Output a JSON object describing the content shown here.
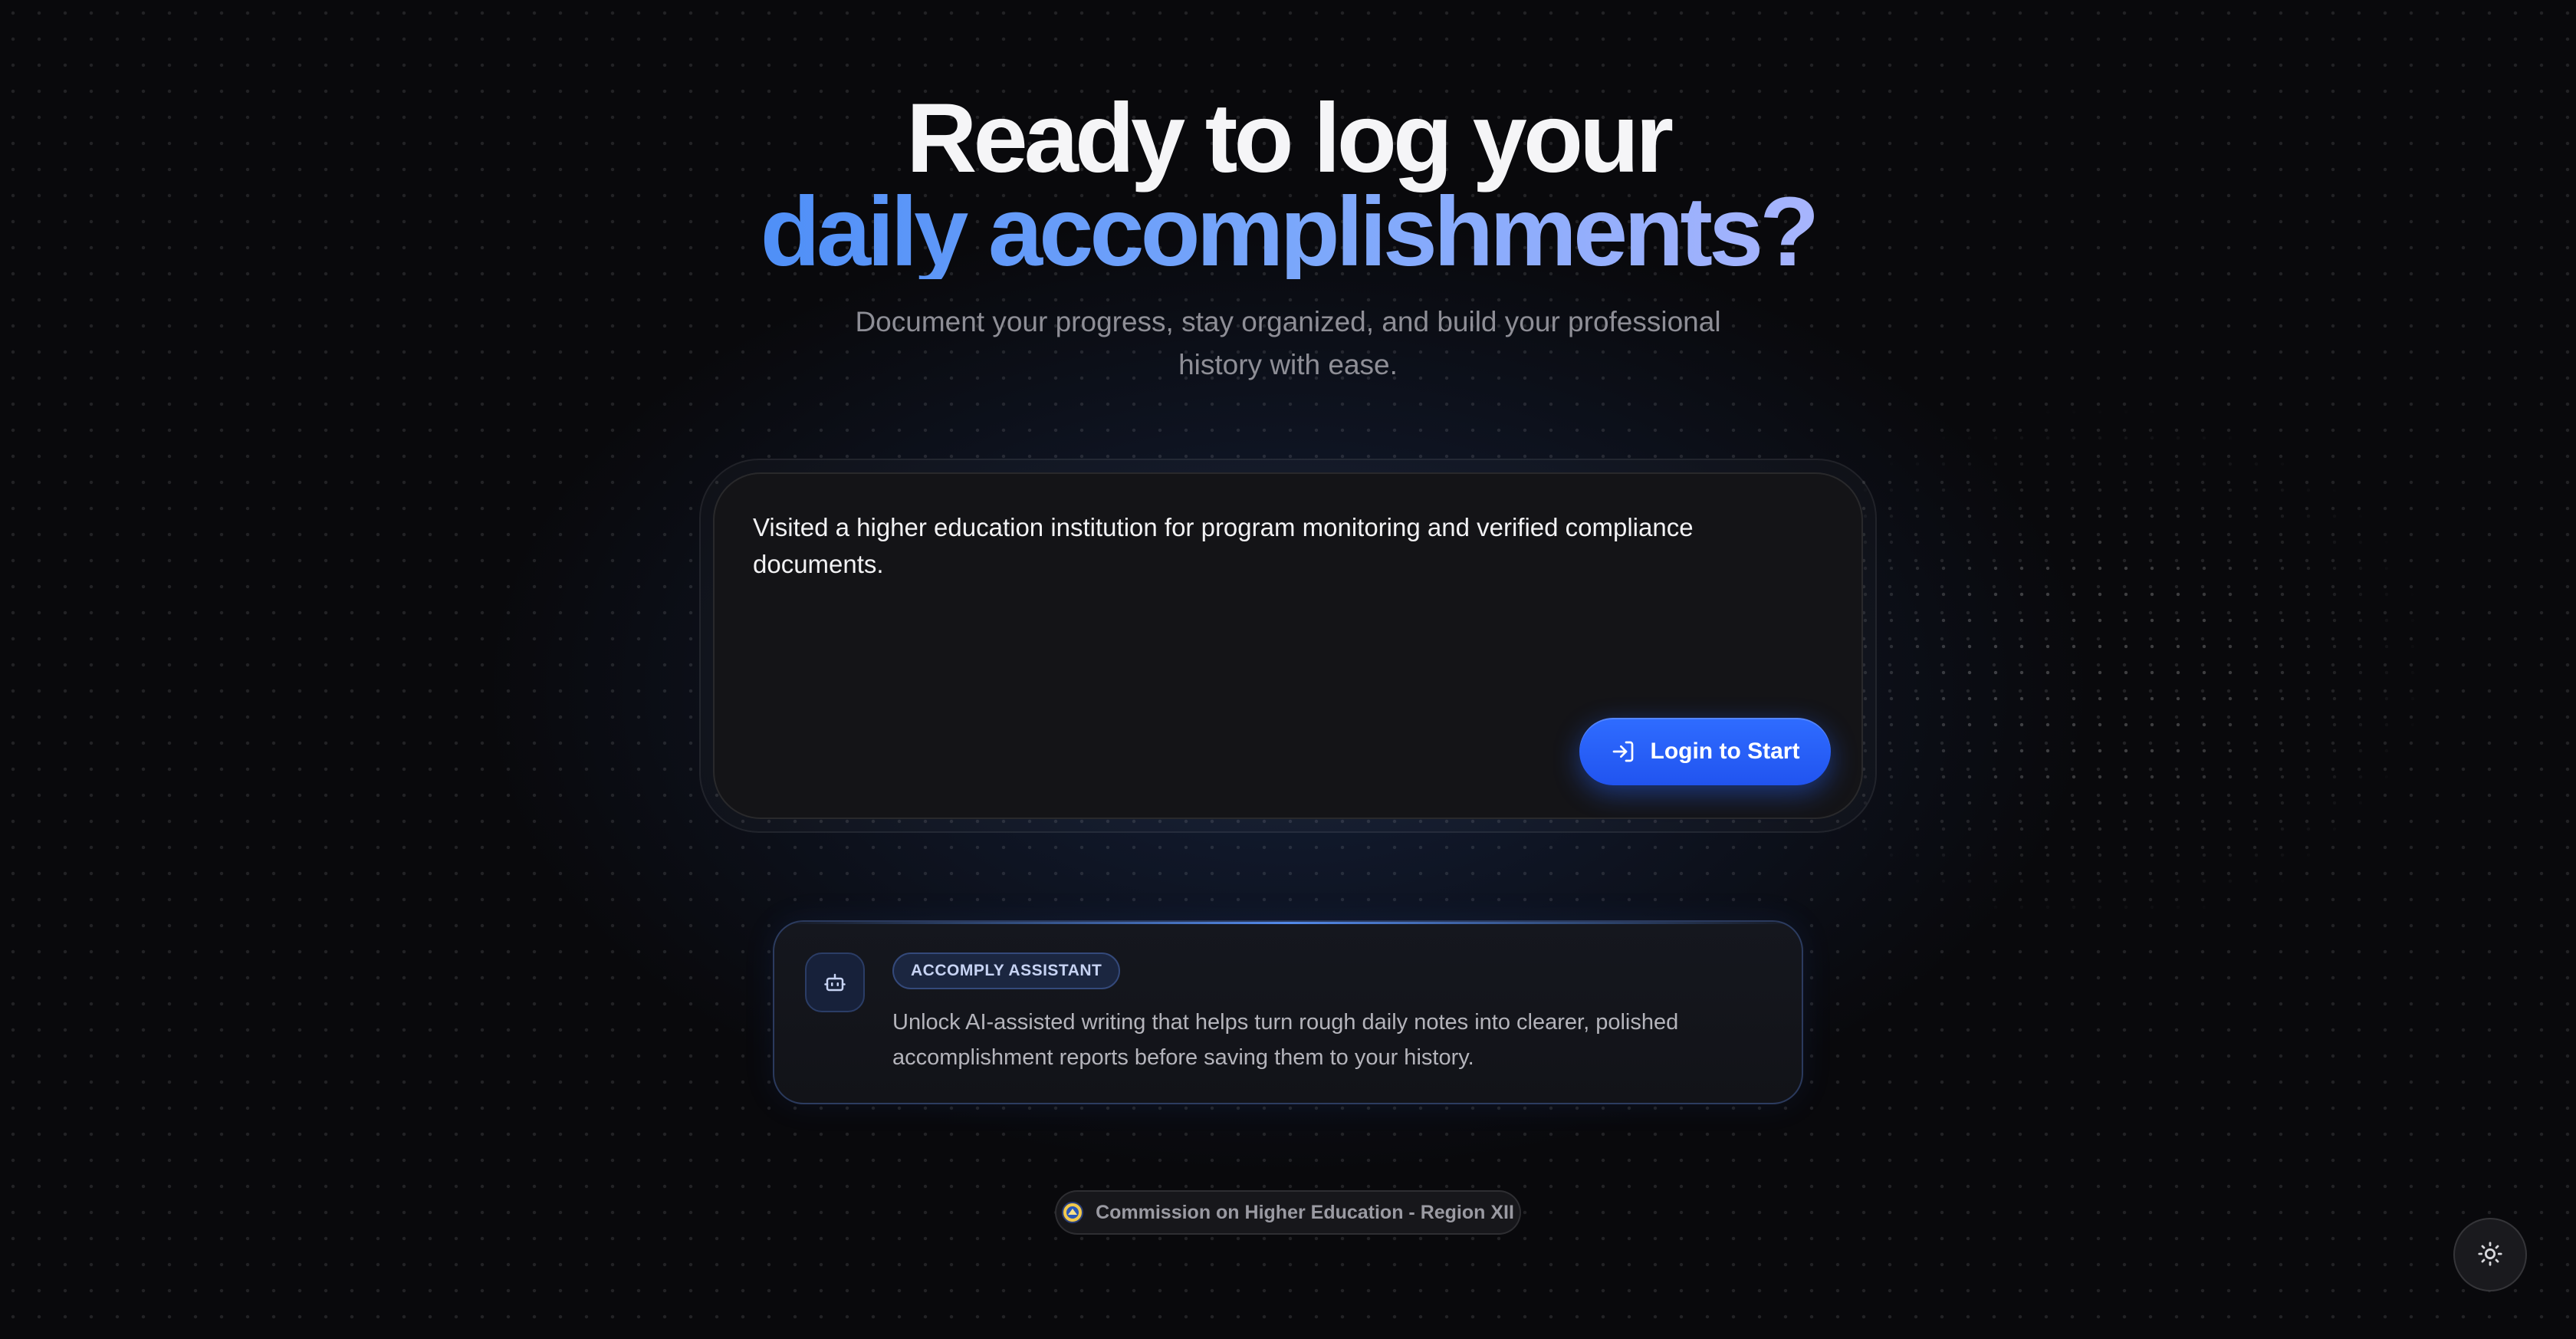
{
  "hero": {
    "headline_line1": "Ready to log your",
    "headline_line2": "daily accomplishments?",
    "subtitle": "Document your progress, stay organized, and build your professional history with ease."
  },
  "entry": {
    "text": "Visited a higher education institution for program monitoring and verified compliance documents.",
    "login_button_label": "Login to Start",
    "login_icon": "login-arrow-icon"
  },
  "assistant": {
    "icon": "robot-icon",
    "badge": "ACCOMPLY ASSISTANT",
    "description": "Unlock AI-assisted writing that helps turn rough daily notes into clearer, polished accomplishment reports before saving them to your history."
  },
  "footer": {
    "organization": "Commission on Higher Education - Region XII",
    "icon": "seal-icon"
  },
  "theme_toggle": {
    "icon": "sun-icon"
  },
  "colors": {
    "background": "#09090c",
    "accent": "#2f6cff",
    "headline_gradient_start": "#4f8ff7",
    "headline_gradient_end": "#a7b4fd"
  }
}
